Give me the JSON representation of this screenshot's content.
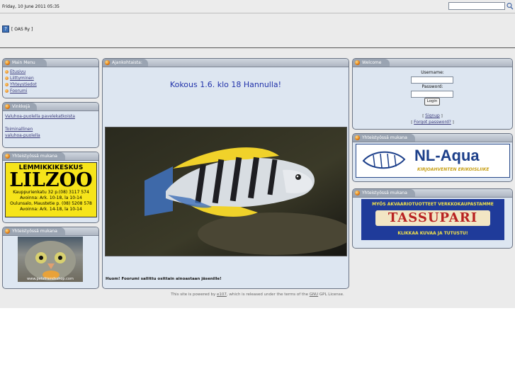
{
  "header": {
    "date": "Friday, 10 June 2011 05:35",
    "site_name": "[ OAS Ry ]"
  },
  "search": {
    "placeholder": "",
    "value": ""
  },
  "left": {
    "main_menu": {
      "title": "Main Menu",
      "items": [
        "Etusivu",
        "Liittyminen",
        "Yhteystiedot",
        "Foorumi"
      ]
    },
    "vinkkeja": {
      "title": "Vinkkejä",
      "links": [
        "Valuhoa-puolella pavelekatkoista",
        "Toiminallinen",
        "valuhoa-puolella"
      ]
    },
    "partner1": {
      "title": "Yhteistyössä mukana",
      "ad": {
        "line1": "LEMMIKKIKESKUS",
        "line2": "LILZOO",
        "line3": "Kauppurienkatu 32 p.(08) 3117 574",
        "line4": "Avoinna: Ark. 10-18, la 10-14",
        "line5": "Oulunsalo, Maustetie p. (08) 5208 578",
        "line6": "Avoinna: Ark. 14-18, la 10-14"
      }
    },
    "partner2": {
      "title": "Yhteistyössä mukana",
      "ad_caption": "www.petsfriendsshop.com"
    }
  },
  "center": {
    "title": "Ajankohtaista:",
    "headline": "Kokous 1.6. klo 18 Hannulla!",
    "notice": "Huom! Foorumi sallittu osittain ainoastaan jäsenille!"
  },
  "right": {
    "welcome": {
      "title": "Welcome",
      "username_label": "Username:",
      "password_label": "Password:",
      "login_label": "Login",
      "signup": "Signup",
      "forgot": "Forgot password?"
    },
    "partner3": {
      "title": "Yhteistyössä mukana",
      "brand": "NL-Aqua",
      "tagline": "KIRJOAHVENTEN ERIKOISLIIKE"
    },
    "partner4": {
      "title": "Yhteistyössä mukana",
      "top": "MYÖS AKVAARIOTUOTTEET VERKKOKAUPASTAMME",
      "brand": "TASSUPARI",
      "bottom": "KLIKKAA KUVAA JA TUTUSTU!"
    }
  },
  "footer": {
    "prefix": "This site is powered by",
    "link1": "e107",
    "middle": ", which is released under the terms of the",
    "link2": "GNU",
    "suffix": "GPL License."
  },
  "colors": {
    "accent_orange": "#e07a12",
    "box_bg": "#dde6f1",
    "headline": "#2233aa"
  }
}
